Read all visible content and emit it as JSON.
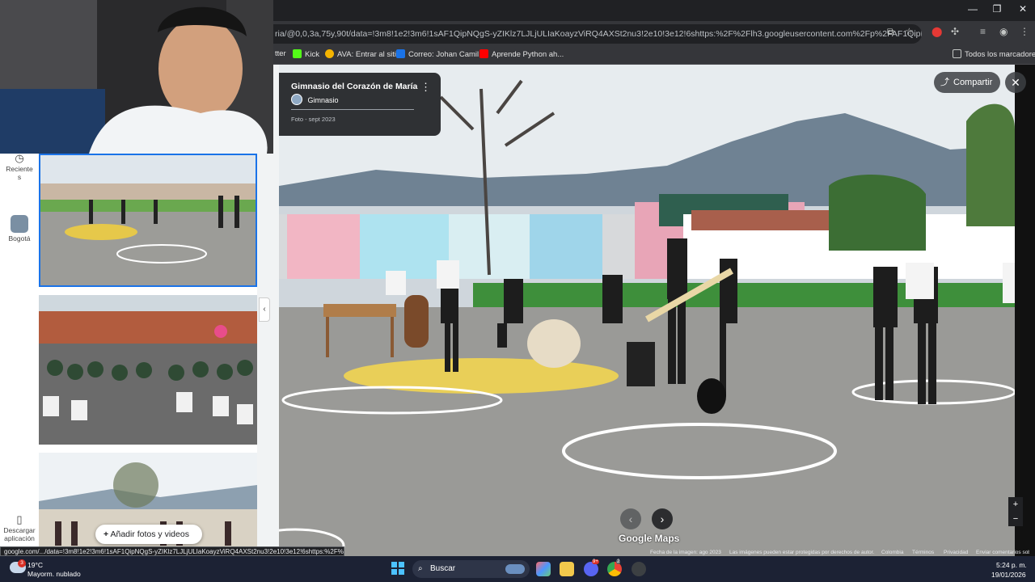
{
  "browser": {
    "url_fragment": "ria/@0,0,3a,75y,90t/data=!3m8!1e2!3m6!1sAF1QipNQgS-yZIKlz7LJLjULIaKoayzViRQ4AXSt2nu3!2e10!3e12!6shttps:%2F%2Flh3.googleusercontent.com%2Fp%2FAF1QipNQgS-yZIKz...",
    "window_controls": [
      "—",
      "❐",
      "✕"
    ],
    "bookmarks": [
      {
        "label": "tter"
      },
      {
        "label": "Kick",
        "color": "#53fc18"
      },
      {
        "label": "AVA: Entrar al sitio",
        "color": "#f4b400"
      },
      {
        "label": "Correo: Johan Camil...",
        "color": "#1a73e8"
      },
      {
        "label": "Aprende Python ah...",
        "color": "#ff0000"
      }
    ],
    "all_bookmarks": "Todos los marcadores"
  },
  "left_rail": {
    "recent_label": "Reciente\ns",
    "place_label": "Bogotá",
    "download_label": "Descargar aplicación"
  },
  "place_card": {
    "title": "Gimnasio del Corazón de María",
    "category": "Gimnasio",
    "photo_date": "Foto - sept 2023"
  },
  "photo_viewer": {
    "share_label": "Compartir",
    "close_label": "✕",
    "prev": "‹",
    "next": "›",
    "logo": "Google Maps",
    "zoom_in": "+",
    "zoom_out": "−",
    "attribution": [
      "Fecha de la imagen: ago 2023",
      "Las imágenes pueden estar protegidas por derechos de autor.",
      "Colombia",
      "Términos",
      "Privacidad",
      "Enviar comentarios sobre el producto"
    ]
  },
  "add_photos_label": "Añadir fotos y videos",
  "status_url": "google.com/.../data=!3m8!1e2!3m6!1sAF1QipNQgS-yZIKlz7LJLjULIaKoayzViRQ4AXSt2nu3!2e10!3e12!6shttps:%2F%2Fl...",
  "taskbar": {
    "weather_temp": "19°C",
    "weather_desc": "Mayorm. nublado",
    "search_placeholder": "Buscar",
    "time": "5:24 p. m.",
    "date": "19/01/2026",
    "weather_badge": "3",
    "app_badges": [
      "9+",
      "2"
    ]
  },
  "colors": {
    "accent": "#1a73e8",
    "taskbar": "#1c2234",
    "chrome_dark": "#202124",
    "chrome_toolbar": "#35363a"
  }
}
